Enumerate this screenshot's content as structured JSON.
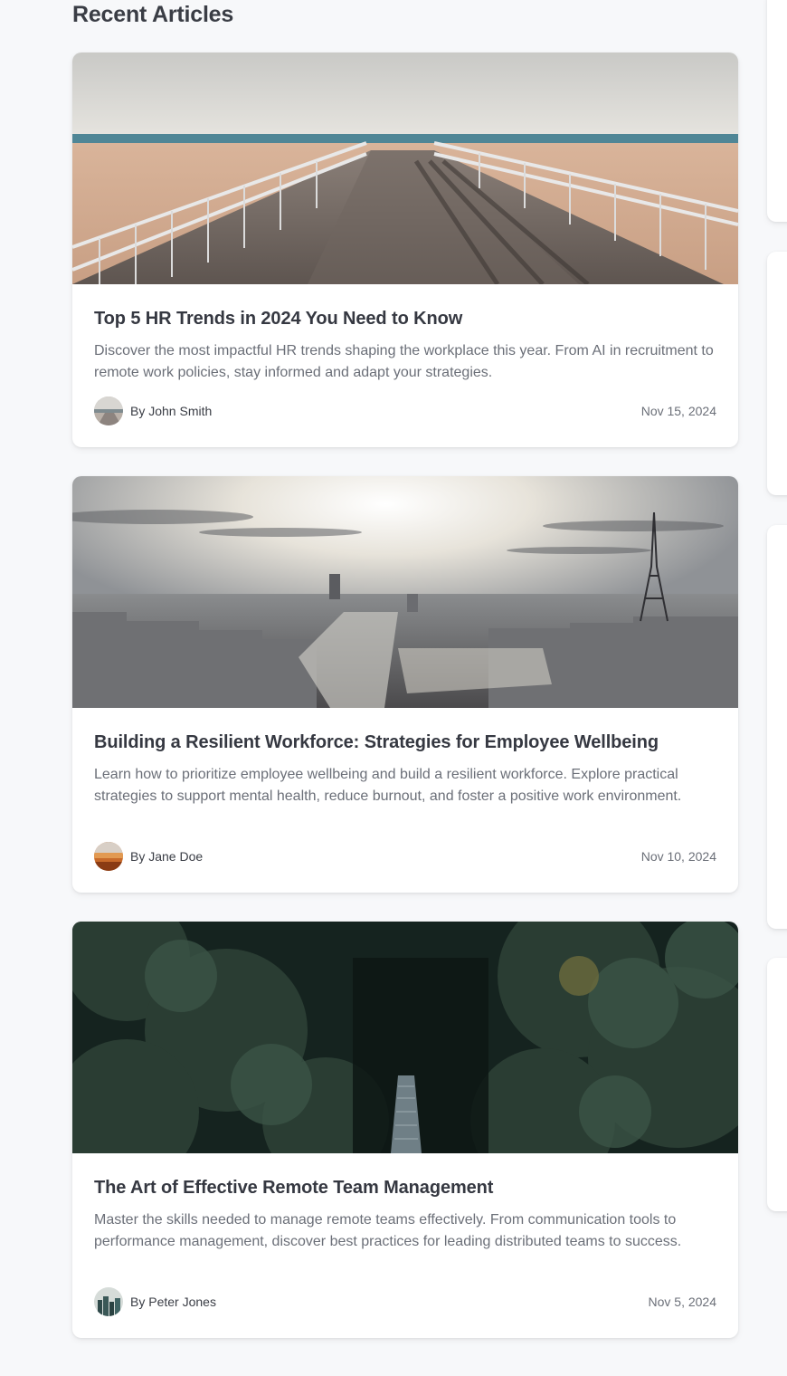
{
  "section": {
    "title": "Recent Articles"
  },
  "articles": [
    {
      "title": "Top 5 HR Trends in 2024 You Need to Know",
      "excerpt": "Discover the most impactful HR trends shaping the workplace this year. From AI in recruitment to remote work policies, stay informed and adapt your strategies.",
      "author": "By John Smith",
      "date": "Nov 15, 2024",
      "image_icon": "beach-boardwalk-image",
      "avatar_icon": "beach-avatar"
    },
    {
      "title": "Building a Resilient Workforce: Strategies for Employee Wellbeing",
      "excerpt": "Learn how to prioritize employee wellbeing and build a resilient workforce. Explore practical strategies to support mental health, reduce burnout, and foster a positive work environment.",
      "author": "By Jane Doe",
      "date": "Nov 10, 2024",
      "image_icon": "paris-skyline-image",
      "avatar_icon": "sunset-avatar"
    },
    {
      "title": "The Art of Effective Remote Team Management",
      "excerpt": "Master the skills needed to manage remote teams effectively. From communication tools to performance management, discover best practices for leading distributed teams to success.",
      "author": "By Peter Jones",
      "date": "Nov 5, 2024",
      "image_icon": "forest-bridge-image",
      "avatar_icon": "city-avatar"
    }
  ],
  "colors": {
    "page_background": "#f7f8fa",
    "card_background": "#ffffff",
    "title_text": "#353841",
    "muted_text": "#6b6f78"
  }
}
